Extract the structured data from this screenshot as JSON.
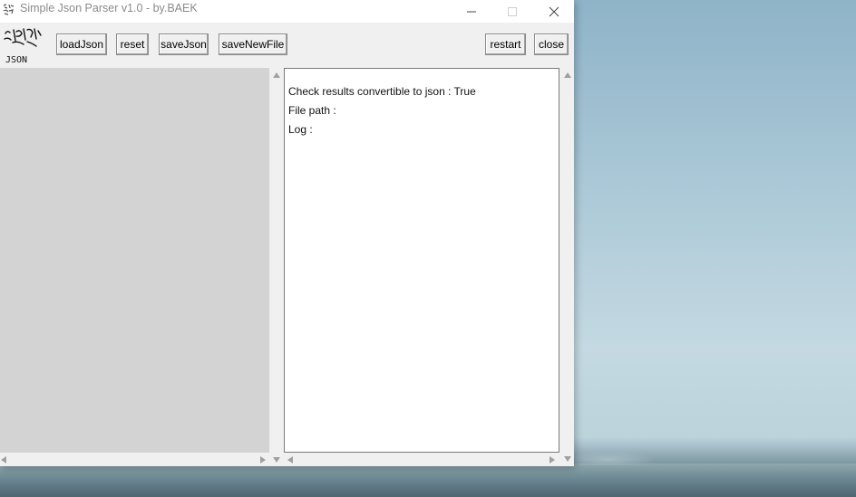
{
  "window": {
    "title": "Simple Json Parser v1.0 - by.BAEK"
  },
  "logo": {
    "text": "JSON"
  },
  "toolbar": {
    "buttons": [
      {
        "id": "loadJson",
        "label": "loadJson"
      },
      {
        "id": "reset",
        "label": "reset"
      },
      {
        "id": "saveJson",
        "label": "saveJson"
      },
      {
        "id": "saveNewFile",
        "label": "saveNewFile"
      },
      {
        "id": "restart",
        "label": "restart"
      },
      {
        "id": "close",
        "label": "close"
      }
    ]
  },
  "output": {
    "lines": [
      "Check results convertible to json : True",
      "File path :",
      "Log :"
    ]
  },
  "icons": {
    "app": "json-doodle-icon",
    "minimize": "minimize-icon",
    "maximize": "maximize-icon",
    "close": "close-icon"
  },
  "colors": {
    "window_bg": "#f0f0f0",
    "tree_pane_bg": "#d3d3d3",
    "text_bg": "#ffffff",
    "title_text": "#8a8a8a"
  }
}
